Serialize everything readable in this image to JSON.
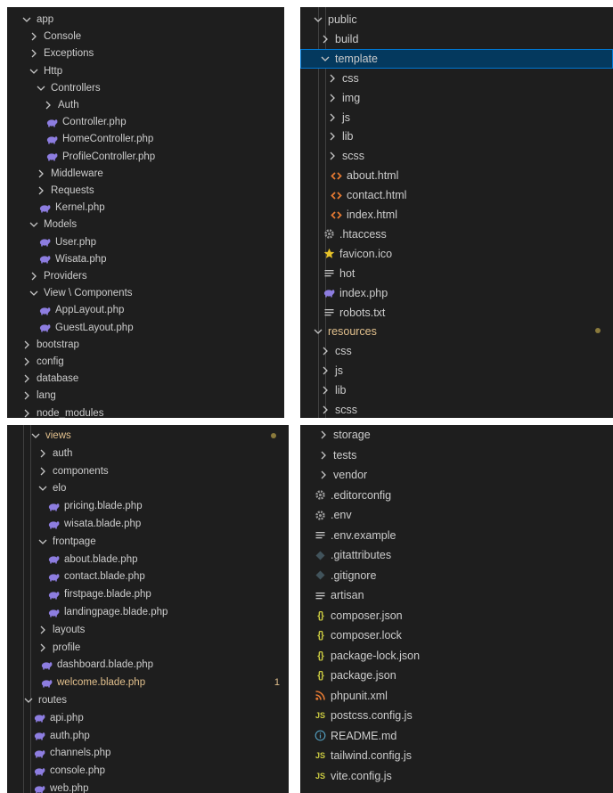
{
  "colors": {
    "panel_bg": "#1e1e1e",
    "text": "#cccccc",
    "git_modified": "#e2c08d",
    "selected_bg": "#04395e",
    "php_icon": "#8d7de0",
    "html_icon": "#e37933",
    "json_icon": "#cbcb41",
    "js_icon": "#cbcb41",
    "favicon_icon": "#e6c229",
    "xml_icon": "#e37933",
    "info_icon": "#519aba"
  },
  "panels": [
    {
      "id": "top-left",
      "items": [
        {
          "label": "app",
          "type": "folder-open",
          "depth": 0
        },
        {
          "label": "Console",
          "type": "folder",
          "depth": 1
        },
        {
          "label": "Exceptions",
          "type": "folder",
          "depth": 1
        },
        {
          "label": "Http",
          "type": "folder-open",
          "depth": 1
        },
        {
          "label": "Controllers",
          "type": "folder-open",
          "depth": 2
        },
        {
          "label": "Auth",
          "type": "folder",
          "depth": 3
        },
        {
          "label": "Controller.php",
          "type": "php",
          "depth": 3
        },
        {
          "label": "HomeController.php",
          "type": "php",
          "depth": 3
        },
        {
          "label": "ProfileController.php",
          "type": "php",
          "depth": 3
        },
        {
          "label": "Middleware",
          "type": "folder",
          "depth": 2
        },
        {
          "label": "Requests",
          "type": "folder",
          "depth": 2
        },
        {
          "label": "Kernel.php",
          "type": "php",
          "depth": 2
        },
        {
          "label": "Models",
          "type": "folder-open",
          "depth": 1
        },
        {
          "label": "User.php",
          "type": "php",
          "depth": 2
        },
        {
          "label": "Wisata.php",
          "type": "php",
          "depth": 2
        },
        {
          "label": "Providers",
          "type": "folder",
          "depth": 1
        },
        {
          "label": "View \\ Components",
          "type": "folder-open",
          "depth": 1
        },
        {
          "label": "AppLayout.php",
          "type": "php",
          "depth": 2
        },
        {
          "label": "GuestLayout.php",
          "type": "php",
          "depth": 2
        },
        {
          "label": "bootstrap",
          "type": "folder",
          "depth": 0
        },
        {
          "label": "config",
          "type": "folder",
          "depth": 0
        },
        {
          "label": "database",
          "type": "folder",
          "depth": 0
        },
        {
          "label": "lang",
          "type": "folder",
          "depth": 0
        },
        {
          "label": "node_modules",
          "type": "folder",
          "depth": 0
        }
      ]
    },
    {
      "id": "top-right",
      "items": [
        {
          "label": "public",
          "type": "folder-open",
          "depth": 0
        },
        {
          "label": "build",
          "type": "folder",
          "depth": 1
        },
        {
          "label": "template",
          "type": "folder-open",
          "depth": 1,
          "selected": true
        },
        {
          "label": "css",
          "type": "folder",
          "depth": 2
        },
        {
          "label": "img",
          "type": "folder",
          "depth": 2
        },
        {
          "label": "js",
          "type": "folder",
          "depth": 2
        },
        {
          "label": "lib",
          "type": "folder",
          "depth": 2
        },
        {
          "label": "scss",
          "type": "folder",
          "depth": 2
        },
        {
          "label": "about.html",
          "type": "html",
          "depth": 2
        },
        {
          "label": "contact.html",
          "type": "html",
          "depth": 2
        },
        {
          "label": "index.html",
          "type": "html",
          "depth": 2
        },
        {
          "label": ".htaccess",
          "type": "gear",
          "depth": 1
        },
        {
          "label": "favicon.ico",
          "type": "star",
          "depth": 1
        },
        {
          "label": "hot",
          "type": "lines",
          "depth": 1
        },
        {
          "label": "index.php",
          "type": "php",
          "depth": 1
        },
        {
          "label": "robots.txt",
          "type": "lines",
          "depth": 1
        },
        {
          "label": "resources",
          "type": "folder-open",
          "depth": 0,
          "git": true,
          "dot": true
        },
        {
          "label": "css",
          "type": "folder",
          "depth": 1
        },
        {
          "label": "js",
          "type": "folder",
          "depth": 1
        },
        {
          "label": "lib",
          "type": "folder",
          "depth": 1
        },
        {
          "label": "scss",
          "type": "folder",
          "depth": 1
        }
      ]
    },
    {
      "id": "bottom-left",
      "items": [
        {
          "label": "views",
          "type": "folder-open",
          "depth": 0,
          "git": true,
          "dot": true
        },
        {
          "label": "auth",
          "type": "folder",
          "depth": 1
        },
        {
          "label": "components",
          "type": "folder",
          "depth": 1
        },
        {
          "label": "elo",
          "type": "folder-open",
          "depth": 1
        },
        {
          "label": "pricing.blade.php",
          "type": "php",
          "depth": 2
        },
        {
          "label": "wisata.blade.php",
          "type": "php",
          "depth": 2
        },
        {
          "label": "frontpage",
          "type": "folder-open",
          "depth": 1
        },
        {
          "label": "about.blade.php",
          "type": "php",
          "depth": 2
        },
        {
          "label": "contact.blade.php",
          "type": "php",
          "depth": 2
        },
        {
          "label": "firstpage.blade.php",
          "type": "php",
          "depth": 2
        },
        {
          "label": "landingpage.blade.php",
          "type": "php",
          "depth": 2
        },
        {
          "label": "layouts",
          "type": "folder",
          "depth": 1
        },
        {
          "label": "profile",
          "type": "folder",
          "depth": 1
        },
        {
          "label": "dashboard.blade.php",
          "type": "php",
          "depth": 1
        },
        {
          "label": "welcome.blade.php",
          "type": "php",
          "depth": 1,
          "git": true,
          "badge": "1"
        },
        {
          "label": "routes",
          "type": "folder-open",
          "depth": -1
        },
        {
          "label": "api.php",
          "type": "php",
          "depth": 0
        },
        {
          "label": "auth.php",
          "type": "php",
          "depth": 0
        },
        {
          "label": "channels.php",
          "type": "php",
          "depth": 0
        },
        {
          "label": "console.php",
          "type": "php",
          "depth": 0
        },
        {
          "label": "web.php",
          "type": "php",
          "depth": 0
        }
      ]
    },
    {
      "id": "bottom-right",
      "items": [
        {
          "label": "storage",
          "type": "folder",
          "depth": 0
        },
        {
          "label": "tests",
          "type": "folder",
          "depth": 0
        },
        {
          "label": "vendor",
          "type": "folder",
          "depth": 0
        },
        {
          "label": ".editorconfig",
          "type": "gear",
          "depth": -1
        },
        {
          "label": ".env",
          "type": "gear",
          "depth": -1
        },
        {
          "label": ".env.example",
          "type": "lines",
          "depth": -1
        },
        {
          "label": ".gitattributes",
          "type": "diamond",
          "depth": -1
        },
        {
          "label": ".gitignore",
          "type": "diamond",
          "depth": -1
        },
        {
          "label": "artisan",
          "type": "lines",
          "depth": -1
        },
        {
          "label": "composer.json",
          "type": "json",
          "depth": -1
        },
        {
          "label": "composer.lock",
          "type": "json",
          "depth": -1
        },
        {
          "label": "package-lock.json",
          "type": "json",
          "depth": -1
        },
        {
          "label": "package.json",
          "type": "json",
          "depth": -1
        },
        {
          "label": "phpunit.xml",
          "type": "rss",
          "depth": -1
        },
        {
          "label": "postcss.config.js",
          "type": "js",
          "depth": -1
        },
        {
          "label": "README.md",
          "type": "info",
          "depth": -1
        },
        {
          "label": "tailwind.config.js",
          "type": "js",
          "depth": -1
        },
        {
          "label": "vite.config.js",
          "type": "js",
          "depth": -1
        }
      ]
    }
  ]
}
